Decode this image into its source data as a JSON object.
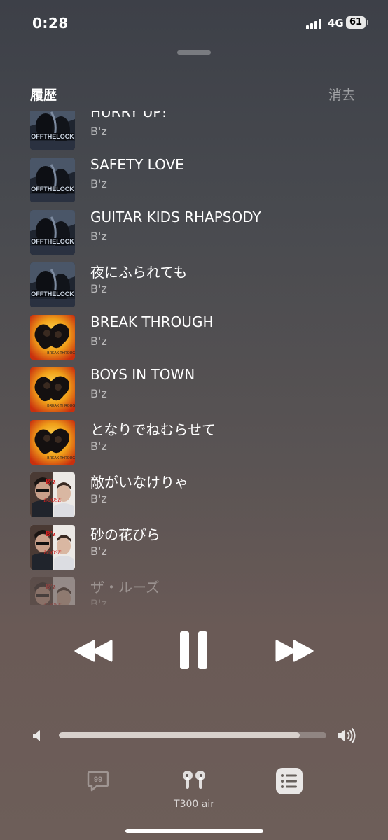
{
  "status": {
    "time": "0:28",
    "network": "4G",
    "battery": "61"
  },
  "header": {
    "title": "履歴",
    "clear_label": "消去"
  },
  "history": [
    {
      "title": "HURRY UP!",
      "artist": "B'z",
      "art": "off-the-lock"
    },
    {
      "title": "SAFETY LOVE",
      "artist": "B'z",
      "art": "off-the-lock"
    },
    {
      "title": "GUITAR KIDS RHAPSODY",
      "artist": "B'z",
      "art": "off-the-lock"
    },
    {
      "title": "夜にふられても",
      "artist": "B'z",
      "art": "off-the-lock"
    },
    {
      "title": "BREAK THROUGH",
      "artist": "B'z",
      "art": "break-through"
    },
    {
      "title": "BOYS IN TOWN",
      "artist": "B'z",
      "art": "break-through"
    },
    {
      "title": "となりでねむらせて",
      "artist": "B'z",
      "art": "break-through"
    },
    {
      "title": "敵がいなけりゃ",
      "artist": "B'z",
      "art": "loose"
    },
    {
      "title": "砂の花びら",
      "artist": "B'z",
      "art": "loose"
    },
    {
      "title": "ザ・ルーズ",
      "artist": "B'z",
      "art": "loose"
    }
  ],
  "playback": {
    "state": "playing",
    "volume": 0.9
  },
  "bottom": {
    "airplay_label": "T300 air",
    "lyrics_icon": "lyrics-icon",
    "airplay_icon": "airpods-icon",
    "queue_icon": "queue-list-icon"
  },
  "colors": {
    "accent": "#ffffff",
    "muted": "#9a9290"
  }
}
